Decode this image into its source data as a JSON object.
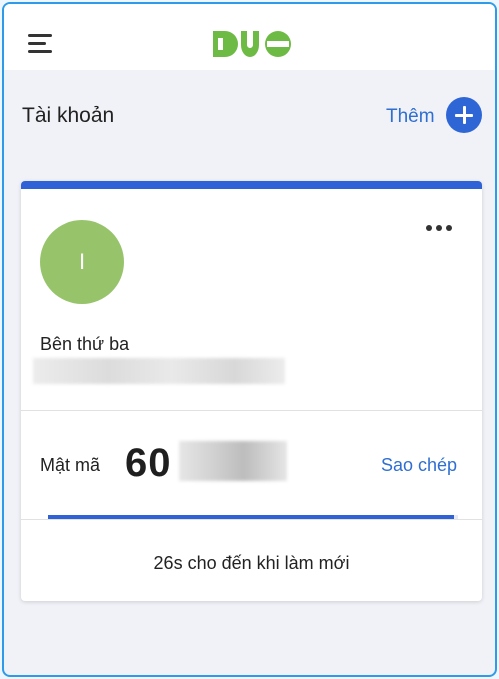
{
  "header": {
    "menu_icon": "hamburger-menu-icon",
    "logo_text": "DUO",
    "brand_color": "#6dbb45"
  },
  "accounts": {
    "title": "Tài khoản",
    "add_label": "Thêm",
    "add_icon": "plus-icon",
    "accent_color": "#2e62d6"
  },
  "card": {
    "avatar_initial": "I",
    "avatar_color": "#97c46b",
    "more_icon": "more-horizontal-icon",
    "account_name": "Bên thứ ba",
    "passcode_label": "Mật mã",
    "passcode_visible": "60",
    "copy_label": "Sao chép",
    "refresh_text": "26s cho đến khi làm mới",
    "refresh_progress_percent": 99
  }
}
